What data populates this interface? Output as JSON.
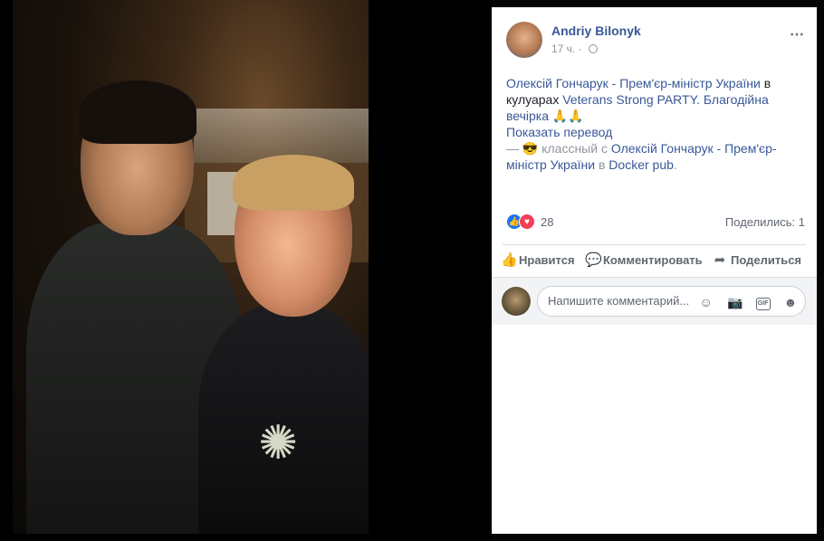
{
  "post": {
    "author": "Andriy Bilonyk",
    "time": "17 ч.",
    "more_icon": "⋯",
    "body": {
      "link1": "Олексій Гончарук - Прем'єр-міністр України",
      "text1": " в кулуарах ",
      "link2": "Veterans Strong PARTY. Благодійна вечірка",
      "emoji1": " 🙏🙏",
      "translate": "Показать перевод",
      "feeling_prefix": "— ",
      "feeling_emoji": "😎",
      "feeling_text": " классный с ",
      "link3": "Олексій Гончарук - Прем'єр-міністр України",
      "text2": " в ",
      "link4": "Docker pub",
      "text3": "."
    },
    "reactions": {
      "count": "28",
      "shares": "Поделились: 1"
    },
    "actions": {
      "like": "Нравится",
      "comment": "Комментировать",
      "share": "Поделиться"
    },
    "composer": {
      "placeholder": "Напишите комментарий..."
    }
  },
  "icons": {
    "like": "like-icon",
    "love": "love-icon",
    "globe": "globe-icon",
    "comment": "comment-icon",
    "share": "share-icon",
    "emoji": "emoji-icon",
    "camera": "camera-icon",
    "gif": "gif-icon",
    "sticker": "sticker-icon"
  },
  "colors": {
    "link": "#385898",
    "muted": "#90949c",
    "like": "#1877f2",
    "love": "#f33e58"
  }
}
